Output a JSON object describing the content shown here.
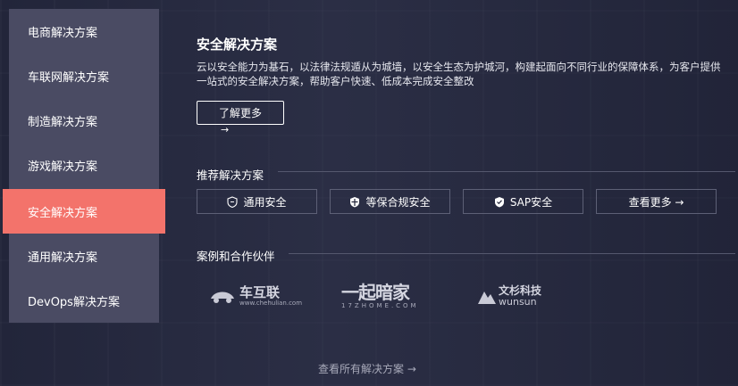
{
  "sidebar": {
    "items": [
      {
        "label": "电商解决方案",
        "active": false
      },
      {
        "label": "车联网解决方案",
        "active": false
      },
      {
        "label": "制造解决方案",
        "active": false
      },
      {
        "label": "游戏解决方案",
        "active": false
      },
      {
        "label": "安全解决方案",
        "active": true
      },
      {
        "label": "通用解决方案",
        "active": false
      },
      {
        "label": "DevOps解决方案",
        "active": false
      }
    ]
  },
  "main": {
    "title": "安全解决方案",
    "description": "云以安全能力为基石，以法律法规遁从为城墙，以安全生态为护城河，构建起面向不同行业的保障体系，为客户提供一站式的安全解决方案，帮助客户快速、低成本完成安全整改",
    "learn_more_label": "了解更多",
    "learn_more_arrow": "→"
  },
  "recommended": {
    "heading": "推荐解决方案",
    "buttons": [
      {
        "label": "通用安全",
        "icon": "shield-outline-icon"
      },
      {
        "label": "等保合规安全",
        "icon": "shield-cross-icon"
      },
      {
        "label": "SAP安全",
        "icon": "shield-filled-icon"
      },
      {
        "label": "查看更多 →",
        "icon": ""
      }
    ]
  },
  "partners": {
    "heading": "案例和合作伙伴",
    "logos": [
      {
        "name": "车互联",
        "sub": "www.chehulian.com"
      },
      {
        "name": "一起暗家",
        "sub": "17ZHOME.COM"
      },
      {
        "name": "文杉科技",
        "sub": "wunsun"
      }
    ]
  },
  "footer": {
    "view_all_label": "查看所有解决方案 →"
  },
  "colors": {
    "accent": "#f3736b",
    "sidebar": "#4a4b63",
    "background": "#22253a"
  }
}
